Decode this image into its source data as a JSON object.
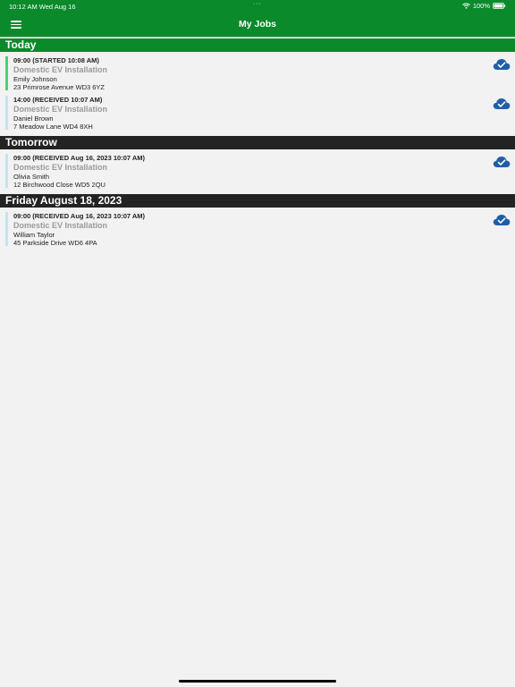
{
  "status_bar": {
    "time_date": "10:12 AM   Wed Aug 16",
    "dots": "···",
    "battery_percent": "100%"
  },
  "header": {
    "title": "My Jobs",
    "menu_icon": "hamburger-menu-icon"
  },
  "sections": [
    {
      "label": "Today",
      "jobs": [
        {
          "time": "09:00 (STARTED 10:08 AM)",
          "title": "Domestic EV Installation",
          "name": "Emily Johnson",
          "address": "23 Primrose Avenue WD3 6YZ",
          "status_color": "#4fd06a",
          "sync_icon": "cloud-check-icon"
        },
        {
          "time": "14:00 (RECEIVED 10:07 AM)",
          "title": "Domestic EV Installation",
          "name": "Daniel Brown",
          "address": "7 Meadow Lane WD4 8XH",
          "status_color": "#c3e3f3",
          "sync_icon": "cloud-check-icon"
        }
      ]
    },
    {
      "label": "Tomorrow",
      "jobs": [
        {
          "time": "09:00 (RECEIVED Aug 16, 2023 10:07 AM)",
          "title": "Domestic EV Installation",
          "name": "Olivia Smith",
          "address": "12 Birchwood Close WD5 2QU",
          "status_color": "#c3e3f3",
          "sync_icon": "cloud-check-icon"
        }
      ]
    },
    {
      "label": "Friday August 18, 2023",
      "jobs": [
        {
          "time": "09:00 (RECEIVED Aug 16, 2023 10:07 AM)",
          "title": "Domestic EV Installation",
          "name": "William Taylor",
          "address": "45 Parkside Drive WD6 4PA",
          "status_color": "#c3e3f3",
          "sync_icon": "cloud-check-icon"
        }
      ]
    }
  ],
  "colors": {
    "header_green": "#0a8a2a",
    "section_dark": "#232323",
    "background": "#f2f2f2",
    "cloud_blue": "#1f5fa8"
  }
}
